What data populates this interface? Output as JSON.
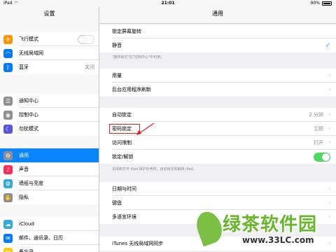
{
  "status_bar": {
    "carrier": "iPad",
    "wifi_icon": "wifi-icon",
    "time": "21:01",
    "battery_percent": "90%",
    "battery_level": 0.9
  },
  "sidebar": {
    "title": "设置",
    "items": [
      {
        "label": "飞行模式",
        "icon": "airplane-icon",
        "color": "#ff9500",
        "control": "toggle-off"
      },
      {
        "label": "无线局域网",
        "icon": "wifi-icon",
        "color": "#007aff"
      },
      {
        "label": "蓝牙",
        "icon": "bluetooth-icon",
        "color": "#007aff",
        "value": "关闭"
      },
      {
        "label": "通知中心",
        "icon": "notification-center-icon",
        "color": "#8e8e93"
      },
      {
        "label": "控制中心",
        "icon": "control-center-icon",
        "color": "#8e8e93"
      },
      {
        "label": "勿扰模式",
        "icon": "moon-icon",
        "color": "#5856d6"
      },
      {
        "label": "通用",
        "icon": "gear-icon",
        "color": "#8e8e93",
        "selected": true
      },
      {
        "label": "声音",
        "icon": "sound-icon",
        "color": "#ff2d55"
      },
      {
        "label": "墙纸与亮度",
        "icon": "wallpaper-icon",
        "color": "#34aadc"
      },
      {
        "label": "隐私",
        "icon": "hand-icon",
        "color": "#8e8e93"
      },
      {
        "label": "iCloud",
        "icon": "cloud-icon",
        "color": "#34aadc"
      },
      {
        "label": "邮件、通讯录、日历",
        "icon": "mail-icon",
        "color": "#007aff"
      },
      {
        "label": "备忘录",
        "icon": "notes-icon",
        "color": "#ffcc00"
      }
    ]
  },
  "main": {
    "title": "通用",
    "rows": [
      {
        "label": "锁定屏幕旋转"
      },
      {
        "label": "静音",
        "control": "check"
      },
      {
        "label": "用量",
        "control": "chevron"
      },
      {
        "label": "后台应用程序刷新",
        "control": "chevron"
      },
      {
        "label": "自动锁定",
        "value": "2 分钟",
        "control": "chevron"
      },
      {
        "label": "密码锁定",
        "value": "立即",
        "control": "chevron",
        "highlighted": true
      },
      {
        "label": "访问限制",
        "value": "打开",
        "control": "chevron"
      },
      {
        "label": "锁定/解锁",
        "control": "toggle-on"
      },
      {
        "label": "日期与时间",
        "control": "chevron"
      },
      {
        "label": "键盘",
        "control": "chevron"
      },
      {
        "label": "多语言环境",
        "control": "chevron"
      },
      {
        "label": "iTunes 无线局域网同步",
        "control": "chevron"
      }
    ],
    "footnotes": {
      "rotation": "\"旋转锁定\"在\"控制中心\"中可用。",
      "lock": "关闭和打开 iPad 保护外壳时，自动锁定和解锁 iPad。"
    }
  },
  "watermark": {
    "text": "绿茶软件园",
    "url": "www.33LC.com",
    "color": "#69b52c"
  },
  "colors": {
    "accent": "#0a84ff",
    "toggle_on": "#4cd964",
    "annotation": "#dd2222"
  }
}
